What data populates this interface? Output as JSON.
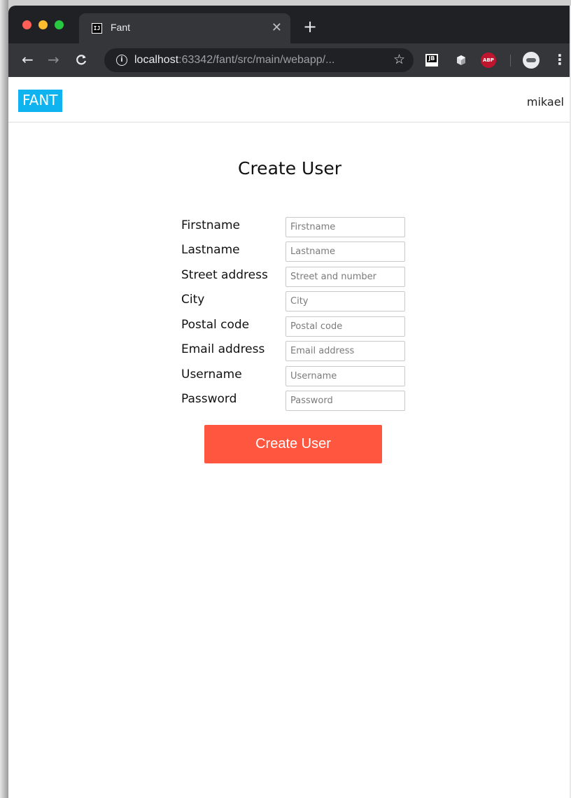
{
  "browser": {
    "tab": {
      "favicon_text": "IJ",
      "title": "Fant",
      "close_glyph": "✕"
    },
    "new_tab_glyph": "+",
    "url_host": "localhost",
    "url_rest": ":63342/fant/src/main/webapp/...",
    "icons": {
      "back": "arrow-left-icon",
      "forward": "arrow-right-icon",
      "reload": "reload-icon",
      "info": "info-icon",
      "bookmark": "star-icon",
      "menu": "more-vert-icon"
    },
    "extensions": {
      "jetbrains": "JB",
      "cube": "cube-icon",
      "adblock": "ABP"
    }
  },
  "app": {
    "logo": "FANT",
    "username": "mikael"
  },
  "form": {
    "title": "Create User",
    "fields": [
      {
        "label": "Firstname",
        "placeholder": "Firstname",
        "value": ""
      },
      {
        "label": "Lastname",
        "placeholder": "Lastname",
        "value": ""
      },
      {
        "label": "Street address",
        "placeholder": "Street and number",
        "value": ""
      },
      {
        "label": "City",
        "placeholder": "City",
        "value": ""
      },
      {
        "label": "Postal code",
        "placeholder": "Postal code",
        "value": ""
      },
      {
        "label": "Email address",
        "placeholder": "Email address",
        "value": ""
      },
      {
        "label": "Username",
        "placeholder": "Username",
        "value": ""
      },
      {
        "label": "Password",
        "placeholder": "Password",
        "value": ""
      }
    ],
    "submit_label": "Create User"
  },
  "colors": {
    "logo_bg": "#0fb3f0",
    "submit_bg": "#ff5640",
    "chrome_dark": "#202124",
    "chrome_toolbar": "#35363a"
  }
}
